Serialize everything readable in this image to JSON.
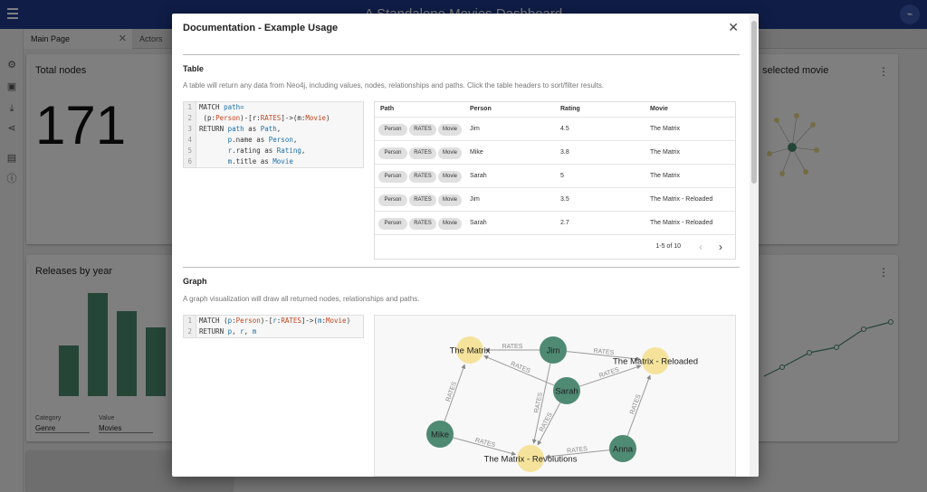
{
  "app": {
    "title": "A Standalone Movies Dashboard"
  },
  "tabs": [
    {
      "label": "Main Page"
    },
    {
      "label": "Actors"
    }
  ],
  "cards": {
    "total_nodes": {
      "title": "Total nodes",
      "value": "171"
    },
    "releases": {
      "title": "Releases by year",
      "category_label": "Category",
      "category_value": "Genre",
      "value_label": "Value",
      "value_value": "Movies"
    },
    "selected_movie": {
      "title": "selected movie"
    }
  },
  "modal": {
    "title": "Documentation - Example Usage",
    "table_section": {
      "title": "Table",
      "description": "A table will return any data from Neo4j, including values, nodes, relationships and paths. Click the table headers to sort/filter results.",
      "code_lines": [
        {
          "n": "1",
          "t": "MATCH path="
        },
        {
          "n": "2",
          "t": " (p:Person)-[r:RATES]->(m:Movie)"
        },
        {
          "n": "3",
          "t": "RETURN path as Path,"
        },
        {
          "n": "4",
          "t": "       p.name as Person,"
        },
        {
          "n": "5",
          "t": "       r.rating as Rating,"
        },
        {
          "n": "6",
          "t": "       m.title as Movie"
        }
      ],
      "headers": [
        "Path",
        "Person",
        "Rating",
        "Movie"
      ],
      "chips": [
        "Person",
        "RATES",
        "Movie"
      ],
      "rows": [
        {
          "person": "Jim",
          "rating": "4.5",
          "movie": "The Matrix"
        },
        {
          "person": "Mike",
          "rating": "3.8",
          "movie": "The Matrix"
        },
        {
          "person": "Sarah",
          "rating": "5",
          "movie": "The Matrix"
        },
        {
          "person": "Jim",
          "rating": "3.5",
          "movie": "The Matrix - Reloaded"
        },
        {
          "person": "Sarah",
          "rating": "2.7",
          "movie": "The Matrix - Reloaded"
        }
      ],
      "pagination": "1-5 of 10"
    },
    "graph_section": {
      "title": "Graph",
      "description": "A graph visualization will draw all returned nodes, relationships and paths.",
      "code_lines": [
        {
          "n": "1",
          "t": "MATCH (p:Person)-[r:RATES]->(m:Movie)"
        },
        {
          "n": "2",
          "t": "RETURN p, r, m"
        }
      ],
      "edge_label": "RATES",
      "nodes": [
        {
          "id": "matrix",
          "label": "The Matrix",
          "kind": "movie"
        },
        {
          "id": "reloaded",
          "label": "The Matrix - Reloaded",
          "kind": "movie"
        },
        {
          "id": "revolutions",
          "label": "The Matrix - Revolutions",
          "kind": "movie"
        },
        {
          "id": "jim",
          "label": "Jim",
          "kind": "person"
        },
        {
          "id": "sarah",
          "label": "Sarah",
          "kind": "person"
        },
        {
          "id": "mike",
          "label": "Mike",
          "kind": "person"
        },
        {
          "id": "anna",
          "label": "Anna",
          "kind": "person"
        }
      ],
      "edges": [
        [
          "jim",
          "matrix"
        ],
        [
          "sarah",
          "matrix"
        ],
        [
          "mike",
          "matrix"
        ],
        [
          "jim",
          "reloaded"
        ],
        [
          "sarah",
          "reloaded"
        ],
        [
          "anna",
          "reloaded"
        ],
        [
          "jim",
          "revolutions"
        ],
        [
          "sarah",
          "revolutions"
        ],
        [
          "mike",
          "revolutions"
        ],
        [
          "anna",
          "revolutions"
        ]
      ]
    }
  }
}
